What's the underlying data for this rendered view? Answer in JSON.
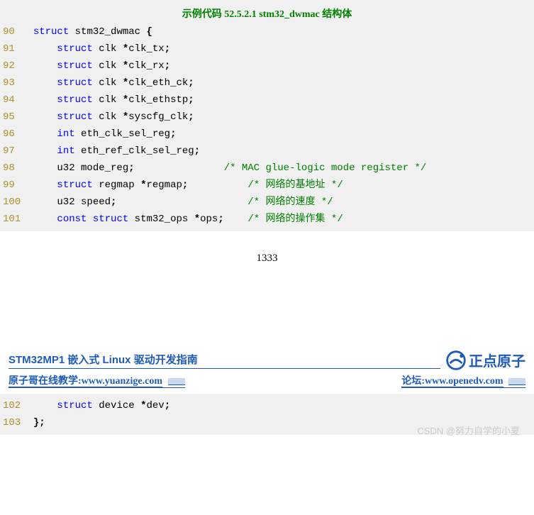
{
  "code": {
    "title": "示例代码 52.5.2.1 stm32_dwmac 结构体",
    "lines": [
      {
        "num": "90",
        "html": "  <span class='kw'>struct</span> stm32_dwmac <span class='punct'>{</span>"
      },
      {
        "num": "91",
        "html": "      <span class='kw'>struct</span> clk <span class='punct'>*</span>clk_tx<span class='punct'>;</span>"
      },
      {
        "num": "92",
        "html": "      <span class='kw'>struct</span> clk <span class='punct'>*</span>clk_rx<span class='punct'>;</span>"
      },
      {
        "num": "93",
        "html": "      <span class='kw'>struct</span> clk <span class='punct'>*</span>clk_eth_ck<span class='punct'>;</span>"
      },
      {
        "num": "94",
        "html": "      <span class='kw'>struct</span> clk <span class='punct'>*</span>clk_ethstp<span class='punct'>;</span>"
      },
      {
        "num": "95",
        "html": "      <span class='kw'>struct</span> clk <span class='punct'>*</span>syscfg_clk<span class='punct'>;</span>"
      },
      {
        "num": "96",
        "html": "      <span class='kw'>int</span> eth_clk_sel_reg<span class='punct'>;</span>"
      },
      {
        "num": "97",
        "html": "      <span class='kw'>int</span> eth_ref_clk_sel_reg<span class='punct'>;</span>"
      },
      {
        "num": "98",
        "html": "      u32 mode_reg<span class='punct'>;</span>               <span class='comment'>/* MAC glue-logic mode register */</span>"
      },
      {
        "num": "99",
        "html": "      <span class='kw'>struct</span> regmap <span class='punct'>*</span>regmap<span class='punct'>;</span>          <span class='comment'>/* 网络的基地址 */</span>"
      },
      {
        "num": "100",
        "html": "      u32 speed<span class='punct'>;</span>                      <span class='comment'>/* 网络的速度 */</span>"
      },
      {
        "num": "101",
        "html": "      <span class='kw'>const</span> <span class='kw'>struct</span> stm32_ops <span class='punct'>*</span>ops<span class='punct'>;</span>    <span class='comment'>/* 网络的操作集 */</span>"
      }
    ],
    "lines2": [
      {
        "num": "102",
        "html": "      <span class='kw'>struct</span> device <span class='punct'>*</span>dev<span class='punct'>;</span>"
      },
      {
        "num": "103",
        "html": "  <span class='punct'>};</span>"
      }
    ]
  },
  "page_number": "1333",
  "footer": {
    "book_title": "STM32MP1 嵌入式 Linux 驱动开发指南",
    "logo_text": "正点原子",
    "link_left_label": "原子哥在线教学:",
    "link_left_url": "www.yuanzige.com",
    "link_right_label": "论坛:",
    "link_right_url": "www.openedv.com"
  },
  "watermark": "CSDN @努力自学的小夏"
}
